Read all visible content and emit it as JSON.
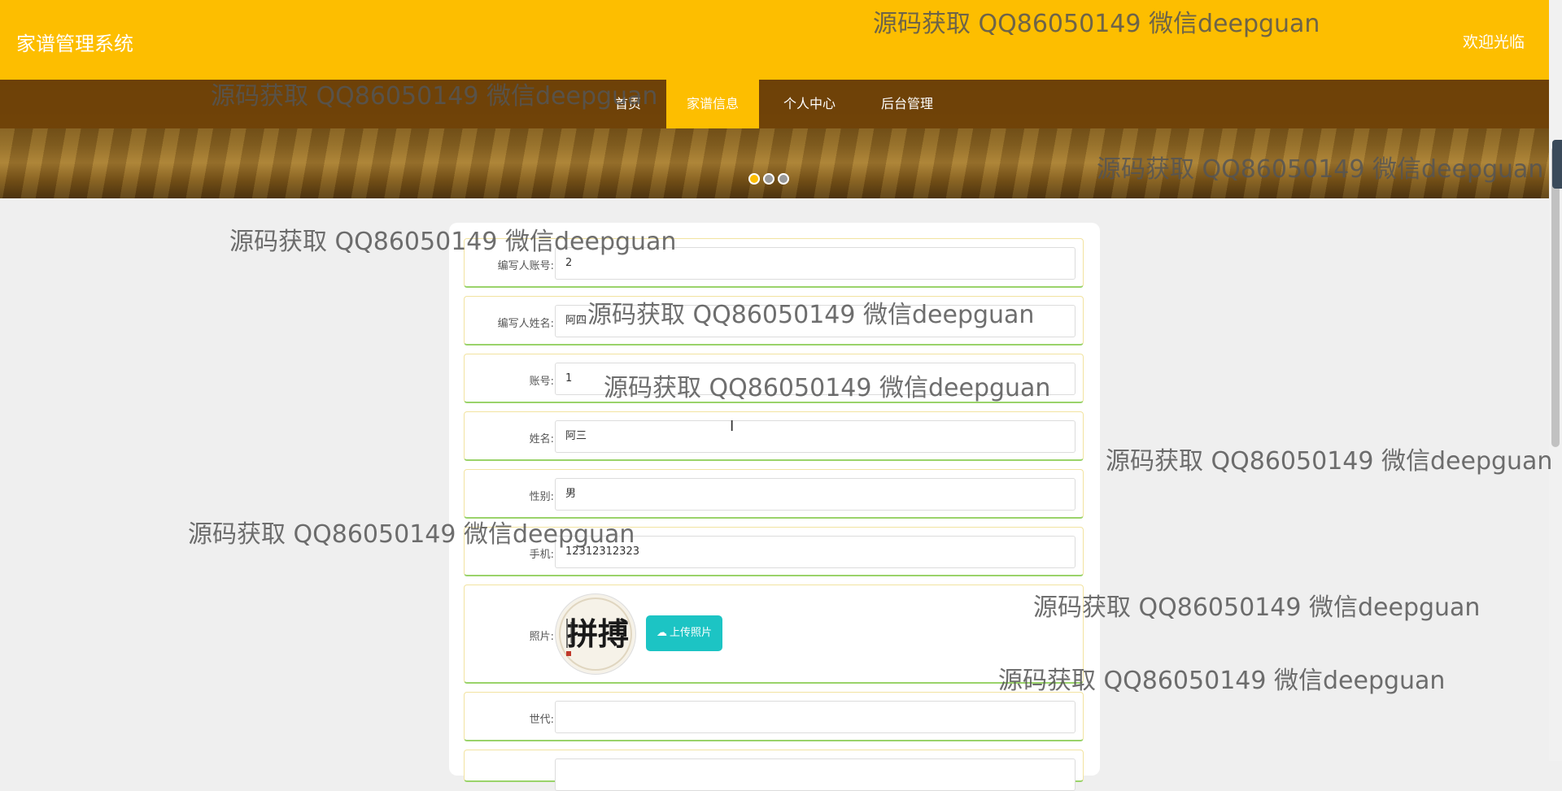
{
  "header": {
    "brand": "家谱管理系统",
    "welcome": "欢迎光临"
  },
  "nav": {
    "items": [
      {
        "label": "首页"
      },
      {
        "label": "家谱信息"
      },
      {
        "label": "个人中心"
      },
      {
        "label": "后台管理"
      }
    ],
    "active_index": 1
  },
  "carousel": {
    "slide_count": 3,
    "active_index": 0
  },
  "form": {
    "fields": [
      {
        "label": "编写人账号:",
        "value": "2"
      },
      {
        "label": "编写人姓名:",
        "value": "阿四"
      },
      {
        "label": "账号:",
        "value": "1"
      },
      {
        "label": "姓名:",
        "value": "阿三"
      },
      {
        "label": "性别:",
        "value": "男"
      },
      {
        "label": "手机:",
        "value": "12312312323"
      }
    ],
    "photo": {
      "label": "照片:",
      "image_text": "拼搏",
      "upload_label": "上传照片",
      "upload_icon": "cloud-upload-icon"
    },
    "generation": {
      "label": "世代:",
      "value": ""
    }
  },
  "watermark": {
    "text": "源码获取 QQ86050149 微信deepguan"
  },
  "colors": {
    "header_bg": "#fdbe00",
    "nav_bg": "#704208",
    "nav_active": "#fdbe00",
    "upload_button": "#1cc4c4",
    "row_bottom_border": "#9ad36a"
  }
}
